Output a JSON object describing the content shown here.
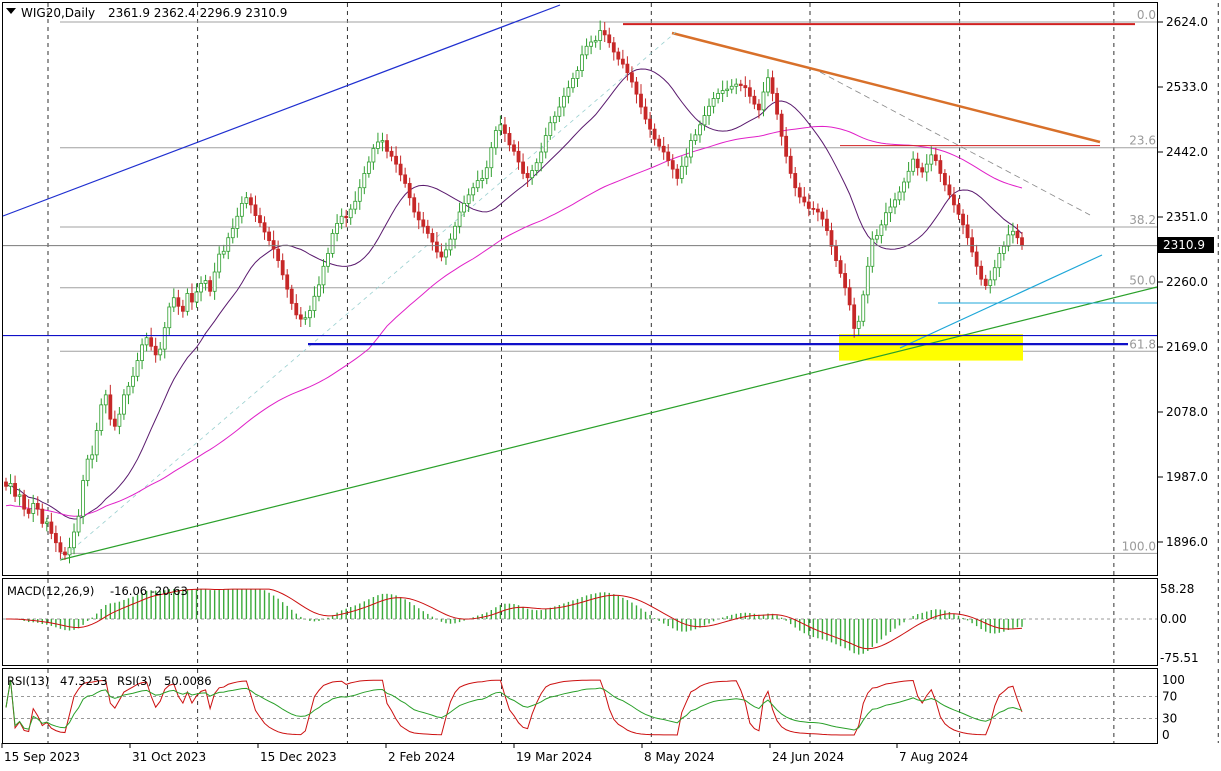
{
  "header": {
    "symbol": "WIG20,Daily",
    "ohlc": "2361.9 2362.4 2296.9 2310.9"
  },
  "last_price_label": "2310.9",
  "colors": {
    "up_candle": "#2e9e2e",
    "down_candle": "#c62828",
    "ma_short": "#5a1a6e",
    "ma_long": "#e020c8",
    "trend_blue": "#1f2fd0",
    "trend_green": "#2aa02a",
    "trend_cyan": "#1ea7d8",
    "trend_orange": "#d8702a",
    "resistance_red": "#d02020",
    "support_blue": "#1010c8",
    "highlight_zone": "#ffff00",
    "macd_hist": "#3aaa3a",
    "macd_signal": "#cc1010",
    "rsi13": "#2aa02a",
    "rsi3": "#cc1010"
  },
  "chart_data": [
    {
      "type": "candlestick",
      "title": "WIG20,Daily",
      "ylim": [
        1870,
        2655
      ],
      "y_ticks": [
        "2624.0",
        "2533.0",
        "2442.0",
        "2351.0",
        "2260.0",
        "2169.0",
        "2078.0",
        "1987.0",
        "1896.0"
      ],
      "x_ticks": [
        "15 Sep 2023",
        "31 Oct 2023",
        "15 Dec 2023",
        "2 Feb 2024",
        "19 Mar 2024",
        "8 May 2024",
        "24 Jun 2024",
        "7 Aug 2024"
      ],
      "last": 2310.9,
      "fibonacci_levels": [
        {
          "label": "0.0",
          "value": 2624.0
        },
        {
          "label": "23.6",
          "value": 2448.0
        },
        {
          "label": "38.2",
          "value": 2337.0
        },
        {
          "label": "50.0",
          "value": 2252.0
        },
        {
          "label": "61.8",
          "value": 2163.0
        },
        {
          "label": "100.0",
          "value": 1880.0
        }
      ],
      "horizontal_lines": [
        {
          "name": "resistance",
          "value": 2621.0
        },
        {
          "name": "resistance",
          "value": 2451.0
        },
        {
          "name": "support",
          "value": 2185.0
        },
        {
          "name": "support",
          "value": 2173.0
        }
      ],
      "highlight_zone": {
        "x_start": "26 Jul 2024",
        "x_end": "11 Sep 2024",
        "y_range": [
          2150,
          2187
        ]
      },
      "series": [
        {
          "kind": "ohlc",
          "x_start": "2023-09-12",
          "step": "trading day",
          "close": [
            1974,
            1978,
            1960,
            1962,
            1942,
            1936,
            1950,
            1942,
            1922,
            1924,
            1908,
            1895,
            1882,
            1878,
            1888,
            1910,
            1932,
            1982,
            2012,
            2018,
            2052,
            2088,
            2102,
            2068,
            2058,
            2075,
            2102,
            2114,
            2128,
            2150,
            2172,
            2182,
            2170,
            2158,
            2166,
            2196,
            2225,
            2238,
            2226,
            2219,
            2244,
            2232,
            2246,
            2258,
            2262,
            2247,
            2274,
            2299,
            2303,
            2322,
            2335,
            2352,
            2370,
            2378,
            2368,
            2353,
            2343,
            2330,
            2318,
            2306,
            2290,
            2270,
            2250,
            2230,
            2214,
            2208,
            2210,
            2220,
            2240,
            2256,
            2282,
            2300,
            2328,
            2342,
            2352,
            2350,
            2362,
            2373,
            2392,
            2412,
            2428,
            2447,
            2456,
            2458,
            2443,
            2436,
            2425,
            2410,
            2398,
            2378,
            2358,
            2347,
            2338,
            2328,
            2316,
            2302,
            2295,
            2305,
            2320,
            2338,
            2358,
            2370,
            2382,
            2392,
            2402,
            2405,
            2420,
            2448,
            2472,
            2480,
            2468,
            2452,
            2443,
            2428,
            2412,
            2406,
            2416,
            2427,
            2442,
            2465,
            2483,
            2492,
            2505,
            2520,
            2532,
            2545,
            2556,
            2578,
            2590,
            2596,
            2598,
            2612,
            2606,
            2595,
            2582,
            2572,
            2565,
            2553,
            2540,
            2523,
            2505,
            2488,
            2474,
            2460,
            2450,
            2442,
            2430,
            2418,
            2405,
            2422,
            2435,
            2458,
            2466,
            2480,
            2493,
            2506,
            2517,
            2524,
            2528,
            2530,
            2534,
            2537,
            2535,
            2532,
            2520,
            2509,
            2501,
            2526,
            2546,
            2524,
            2495,
            2464,
            2436,
            2412,
            2392,
            2379,
            2372,
            2363,
            2362,
            2358,
            2348,
            2332,
            2310,
            2290,
            2272,
            2252,
            2228,
            2195,
            2205,
            2242,
            2282,
            2320,
            2325,
            2340,
            2357,
            2365,
            2375,
            2386,
            2400,
            2415,
            2432,
            2420,
            2414,
            2425,
            2438,
            2430,
            2412,
            2396,
            2382,
            2368,
            2355,
            2340,
            2322,
            2302,
            2282,
            2264,
            2255,
            2263,
            2280,
            2300,
            2310,
            2326,
            2331,
            2322,
            2311
          ]
        },
        {
          "kind": "line",
          "name": "MA-short"
        },
        {
          "kind": "line",
          "name": "MA-long"
        }
      ]
    },
    {
      "type": "line",
      "title": "MACD(12,26,9)",
      "values_text": "-16.06 -20.63",
      "ylim": [
        -75.51,
        58.28
      ],
      "y_ticks": [
        "58.28",
        "0.00",
        "-75.51"
      ]
    },
    {
      "type": "line",
      "title": "RSI(13)",
      "rsi13_value": "47.3253",
      "rsi3_title": "RSI(3)",
      "rsi3_value": "50.0086",
      "ylim": [
        0,
        100
      ],
      "y_ticks": [
        "100",
        "70",
        "30",
        "0"
      ]
    }
  ]
}
